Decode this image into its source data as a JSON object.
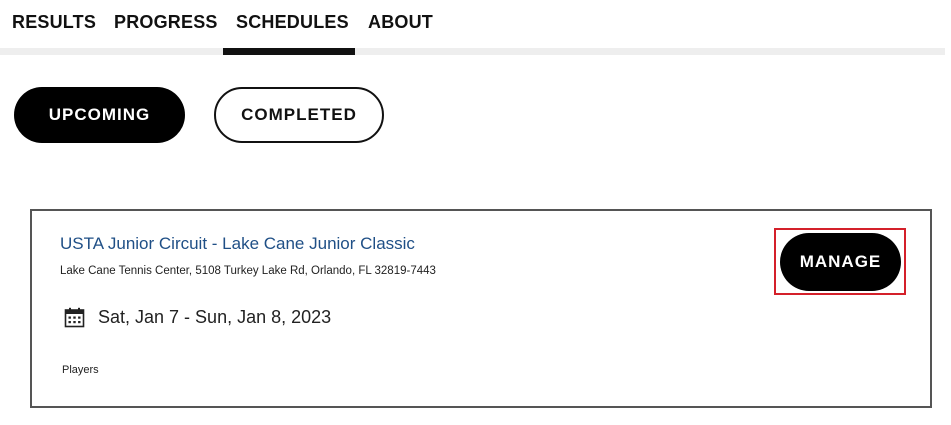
{
  "tabs": [
    {
      "label": "RESULTS"
    },
    {
      "label": "PROGRESS"
    },
    {
      "label": "SCHEDULES",
      "active": true
    },
    {
      "label": "ABOUT"
    }
  ],
  "filters": {
    "upcoming_label": "UPCOMING",
    "completed_label": "COMPLETED",
    "selected": "UPCOMING"
  },
  "event": {
    "title": "USTA Junior Circuit - Lake Cane Junior Classic",
    "address": "Lake Cane Tennis Center, 5108 Turkey Lake Rd, Orlando, FL 32819-7443",
    "date_range": "Sat, Jan 7 - Sun, Jan 8, 2023",
    "players_label": "Players",
    "manage_label": "MANAGE",
    "icon": "calendar-icon"
  },
  "colors": {
    "title_link": "#1f4f86",
    "active_underline": "#111111",
    "primary_button": "#000000",
    "highlight_box": "#d4202a"
  }
}
